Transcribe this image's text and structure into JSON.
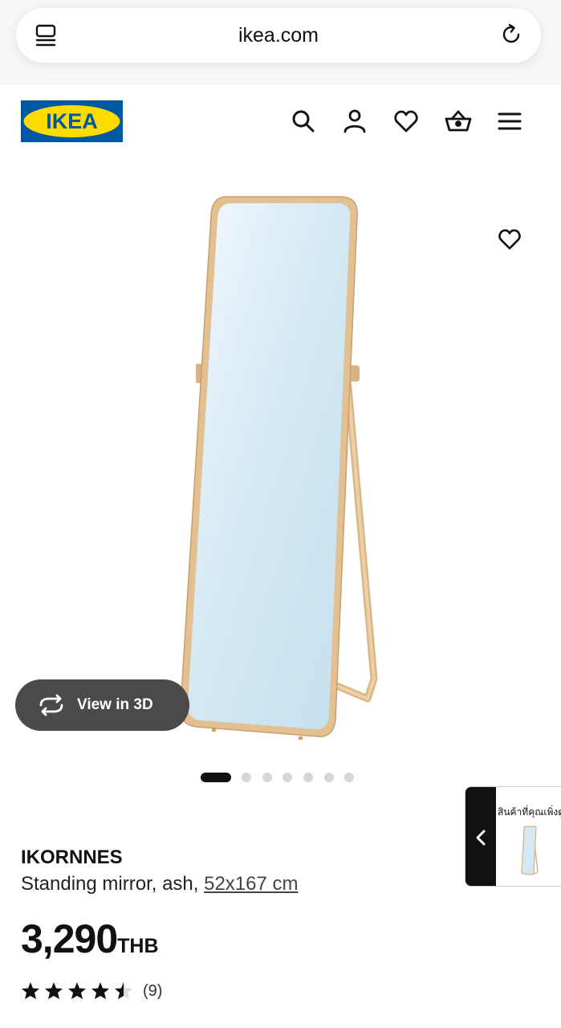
{
  "browser": {
    "url": "ikea.com",
    "tabs_icon": "tabs-icon",
    "reload_icon": "reload-icon"
  },
  "header": {
    "logo_text": "IKEA",
    "icons": [
      "search-icon",
      "user-icon",
      "heart-icon",
      "basket-icon",
      "menu-icon"
    ],
    "colors": {
      "logo_blue": "#0058a3",
      "logo_yellow": "#ffdb00"
    }
  },
  "gallery": {
    "view_3d_label": "View in 3D",
    "image_count": 7,
    "active_index": 0,
    "favourite_icon": "heart-icon"
  },
  "recently_viewed": {
    "title": "สินค้าที่คุณเพิ่งดู",
    "toggle_icon": "chevron-left-icon"
  },
  "product": {
    "name": "IKORNNES",
    "description": "Standing mirror, ash,",
    "size": "52x167 cm",
    "price": "3,290",
    "currency": "THB",
    "rating": 4.5,
    "rating_max": 5,
    "review_count": "(9)"
  }
}
